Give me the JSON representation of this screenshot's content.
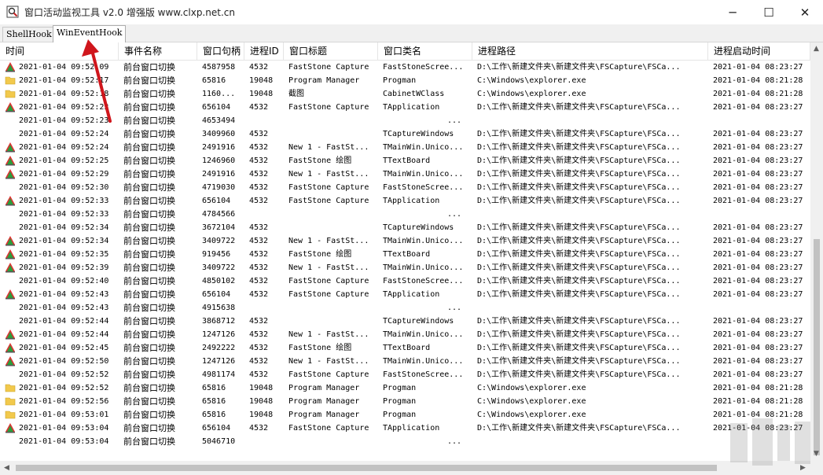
{
  "window": {
    "title": "窗口活动监视工具 v2.0 增强版 www.clxp.net.cn",
    "minimize_glyph": "─",
    "maximize_glyph": "☐",
    "close_glyph": "✕"
  },
  "tabs": [
    {
      "label": "ShellHook",
      "active": false
    },
    {
      "label": "WinEventHook",
      "active": true
    }
  ],
  "columns": [
    "时间",
    "事件名称",
    "窗口句柄",
    "进程ID",
    "窗口标题",
    "窗口类名",
    "进程路径",
    "进程启动时间"
  ],
  "rows": [
    {
      "icon": "faststone-icon",
      "time": "2021-01-04 09:52:09",
      "event": "前台窗口切换",
      "handle": "4587958",
      "pid": "4532",
      "title": "FastStone Capture",
      "cls": "FastStoneScree...",
      "path": "D:\\工作\\新建文件夹\\新建文件夹\\FSCapture\\FSCa...",
      "start": "2021-01-04 08:23:27"
    },
    {
      "icon": "folder-icon",
      "time": "2021-01-04 09:52:17",
      "event": "前台窗口切换",
      "handle": "65816",
      "pid": "19048",
      "title": "Program Manager",
      "cls": "Progman",
      "path": "C:\\Windows\\explorer.exe",
      "start": "2021-01-04 08:21:28"
    },
    {
      "icon": "folder-icon",
      "time": "2021-01-04 09:52:18",
      "event": "前台窗口切换",
      "handle": "1160...",
      "pid": "19048",
      "title": "截图",
      "cls": "CabinetWClass",
      "path": "C:\\Windows\\explorer.exe",
      "start": "2021-01-04 08:21:28"
    },
    {
      "icon": "faststone-icon",
      "time": "2021-01-04 09:52:23",
      "event": "前台窗口切换",
      "handle": "656104",
      "pid": "4532",
      "title": "FastStone Capture",
      "cls": "TApplication",
      "path": "D:\\工作\\新建文件夹\\新建文件夹\\FSCapture\\FSCa...",
      "start": "2021-01-04 08:23:27"
    },
    {
      "icon": "",
      "time": "2021-01-04 09:52:23",
      "event": "前台窗口切换",
      "handle": "4653494",
      "pid": "",
      "title": "",
      "cls": "...",
      "path": "",
      "start": ""
    },
    {
      "icon": "",
      "time": "2021-01-04 09:52:24",
      "event": "前台窗口切换",
      "handle": "3409960",
      "pid": "4532",
      "title": "",
      "cls": "TCaptureWindows",
      "path": "D:\\工作\\新建文件夹\\新建文件夹\\FSCapture\\FSCa...",
      "start": "2021-01-04 08:23:27"
    },
    {
      "icon": "faststone-icon",
      "time": "2021-01-04 09:52:24",
      "event": "前台窗口切换",
      "handle": "2491916",
      "pid": "4532",
      "title": "New 1 - FastSt...",
      "cls": "TMainWin.Unico...",
      "path": "D:\\工作\\新建文件夹\\新建文件夹\\FSCapture\\FSCa...",
      "start": "2021-01-04 08:23:27"
    },
    {
      "icon": "faststone-icon",
      "time": "2021-01-04 09:52:25",
      "event": "前台窗口切换",
      "handle": "1246960",
      "pid": "4532",
      "title": "FastStone 绘图",
      "cls": "TTextBoard",
      "path": "D:\\工作\\新建文件夹\\新建文件夹\\FSCapture\\FSCa...",
      "start": "2021-01-04 08:23:27"
    },
    {
      "icon": "faststone-icon",
      "time": "2021-01-04 09:52:29",
      "event": "前台窗口切换",
      "handle": "2491916",
      "pid": "4532",
      "title": "New 1 - FastSt...",
      "cls": "TMainWin.Unico...",
      "path": "D:\\工作\\新建文件夹\\新建文件夹\\FSCapture\\FSCa...",
      "start": "2021-01-04 08:23:27"
    },
    {
      "icon": "",
      "time": "2021-01-04 09:52:30",
      "event": "前台窗口切换",
      "handle": "4719030",
      "pid": "4532",
      "title": "FastStone Capture",
      "cls": "FastStoneScree...",
      "path": "D:\\工作\\新建文件夹\\新建文件夹\\FSCapture\\FSCa...",
      "start": "2021-01-04 08:23:27"
    },
    {
      "icon": "faststone-icon",
      "time": "2021-01-04 09:52:33",
      "event": "前台窗口切换",
      "handle": "656104",
      "pid": "4532",
      "title": "FastStone Capture",
      "cls": "TApplication",
      "path": "D:\\工作\\新建文件夹\\新建文件夹\\FSCapture\\FSCa...",
      "start": "2021-01-04 08:23:27"
    },
    {
      "icon": "",
      "time": "2021-01-04 09:52:33",
      "event": "前台窗口切换",
      "handle": "4784566",
      "pid": "",
      "title": "",
      "cls": "...",
      "path": "",
      "start": ""
    },
    {
      "icon": "",
      "time": "2021-01-04 09:52:34",
      "event": "前台窗口切换",
      "handle": "3672104",
      "pid": "4532",
      "title": "",
      "cls": "TCaptureWindows",
      "path": "D:\\工作\\新建文件夹\\新建文件夹\\FSCapture\\FSCa...",
      "start": "2021-01-04 08:23:27"
    },
    {
      "icon": "faststone-icon",
      "time": "2021-01-04 09:52:34",
      "event": "前台窗口切换",
      "handle": "3409722",
      "pid": "4532",
      "title": "New 1 - FastSt...",
      "cls": "TMainWin.Unico...",
      "path": "D:\\工作\\新建文件夹\\新建文件夹\\FSCapture\\FSCa...",
      "start": "2021-01-04 08:23:27"
    },
    {
      "icon": "faststone-icon",
      "time": "2021-01-04 09:52:35",
      "event": "前台窗口切换",
      "handle": "919456",
      "pid": "4532",
      "title": "FastStone 绘图",
      "cls": "TTextBoard",
      "path": "D:\\工作\\新建文件夹\\新建文件夹\\FSCapture\\FSCa...",
      "start": "2021-01-04 08:23:27"
    },
    {
      "icon": "faststone-icon",
      "time": "2021-01-04 09:52:39",
      "event": "前台窗口切换",
      "handle": "3409722",
      "pid": "4532",
      "title": "New 1 - FastSt...",
      "cls": "TMainWin.Unico...",
      "path": "D:\\工作\\新建文件夹\\新建文件夹\\FSCapture\\FSCa...",
      "start": "2021-01-04 08:23:27"
    },
    {
      "icon": "",
      "time": "2021-01-04 09:52:40",
      "event": "前台窗口切换",
      "handle": "4850102",
      "pid": "4532",
      "title": "FastStone Capture",
      "cls": "FastStoneScree...",
      "path": "D:\\工作\\新建文件夹\\新建文件夹\\FSCapture\\FSCa...",
      "start": "2021-01-04 08:23:27"
    },
    {
      "icon": "faststone-icon",
      "time": "2021-01-04 09:52:43",
      "event": "前台窗口切换",
      "handle": "656104",
      "pid": "4532",
      "title": "FastStone Capture",
      "cls": "TApplication",
      "path": "D:\\工作\\新建文件夹\\新建文件夹\\FSCapture\\FSCa...",
      "start": "2021-01-04 08:23:27"
    },
    {
      "icon": "",
      "time": "2021-01-04 09:52:43",
      "event": "前台窗口切换",
      "handle": "4915638",
      "pid": "",
      "title": "",
      "cls": "...",
      "path": "",
      "start": ""
    },
    {
      "icon": "",
      "time": "2021-01-04 09:52:44",
      "event": "前台窗口切换",
      "handle": "3868712",
      "pid": "4532",
      "title": "",
      "cls": "TCaptureWindows",
      "path": "D:\\工作\\新建文件夹\\新建文件夹\\FSCapture\\FSCa...",
      "start": "2021-01-04 08:23:27"
    },
    {
      "icon": "faststone-icon",
      "time": "2021-01-04 09:52:44",
      "event": "前台窗口切换",
      "handle": "1247126",
      "pid": "4532",
      "title": "New 1 - FastSt...",
      "cls": "TMainWin.Unico...",
      "path": "D:\\工作\\新建文件夹\\新建文件夹\\FSCapture\\FSCa...",
      "start": "2021-01-04 08:23:27"
    },
    {
      "icon": "faststone-icon",
      "time": "2021-01-04 09:52:45",
      "event": "前台窗口切换",
      "handle": "2492222",
      "pid": "4532",
      "title": "FastStone 绘图",
      "cls": "TTextBoard",
      "path": "D:\\工作\\新建文件夹\\新建文件夹\\FSCapture\\FSCa...",
      "start": "2021-01-04 08:23:27"
    },
    {
      "icon": "faststone-icon",
      "time": "2021-01-04 09:52:50",
      "event": "前台窗口切换",
      "handle": "1247126",
      "pid": "4532",
      "title": "New 1 - FastSt...",
      "cls": "TMainWin.Unico...",
      "path": "D:\\工作\\新建文件夹\\新建文件夹\\FSCapture\\FSCa...",
      "start": "2021-01-04 08:23:27"
    },
    {
      "icon": "",
      "time": "2021-01-04 09:52:52",
      "event": "前台窗口切换",
      "handle": "4981174",
      "pid": "4532",
      "title": "FastStone Capture",
      "cls": "FastStoneScree...",
      "path": "D:\\工作\\新建文件夹\\新建文件夹\\FSCapture\\FSCa...",
      "start": "2021-01-04 08:23:27"
    },
    {
      "icon": "folder-icon",
      "time": "2021-01-04 09:52:52",
      "event": "前台窗口切换",
      "handle": "65816",
      "pid": "19048",
      "title": "Program Manager",
      "cls": "Progman",
      "path": "C:\\Windows\\explorer.exe",
      "start": "2021-01-04 08:21:28"
    },
    {
      "icon": "folder-icon",
      "time": "2021-01-04 09:52:56",
      "event": "前台窗口切换",
      "handle": "65816",
      "pid": "19048",
      "title": "Program Manager",
      "cls": "Progman",
      "path": "C:\\Windows\\explorer.exe",
      "start": "2021-01-04 08:21:28"
    },
    {
      "icon": "folder-icon",
      "time": "2021-01-04 09:53:01",
      "event": "前台窗口切换",
      "handle": "65816",
      "pid": "19048",
      "title": "Program Manager",
      "cls": "Progman",
      "path": "C:\\Windows\\explorer.exe",
      "start": "2021-01-04 08:21:28"
    },
    {
      "icon": "faststone-icon",
      "time": "2021-01-04 09:53:04",
      "event": "前台窗口切换",
      "handle": "656104",
      "pid": "4532",
      "title": "FastStone Capture",
      "cls": "TApplication",
      "path": "D:\\工作\\新建文件夹\\新建文件夹\\FSCapture\\FSCa...",
      "start": "2021-01-04 08:23:27"
    },
    {
      "icon": "",
      "time": "2021-01-04 09:53:04",
      "event": "前台窗口切换",
      "handle": "5046710",
      "pid": "",
      "title": "",
      "cls": "...",
      "path": "",
      "start": ""
    }
  ],
  "annotation_color": "#d0161c",
  "scrollbars": {
    "left_arrow": "◀",
    "right_arrow": "▶",
    "up_arrow": "▲",
    "down_arrow": "▼"
  }
}
